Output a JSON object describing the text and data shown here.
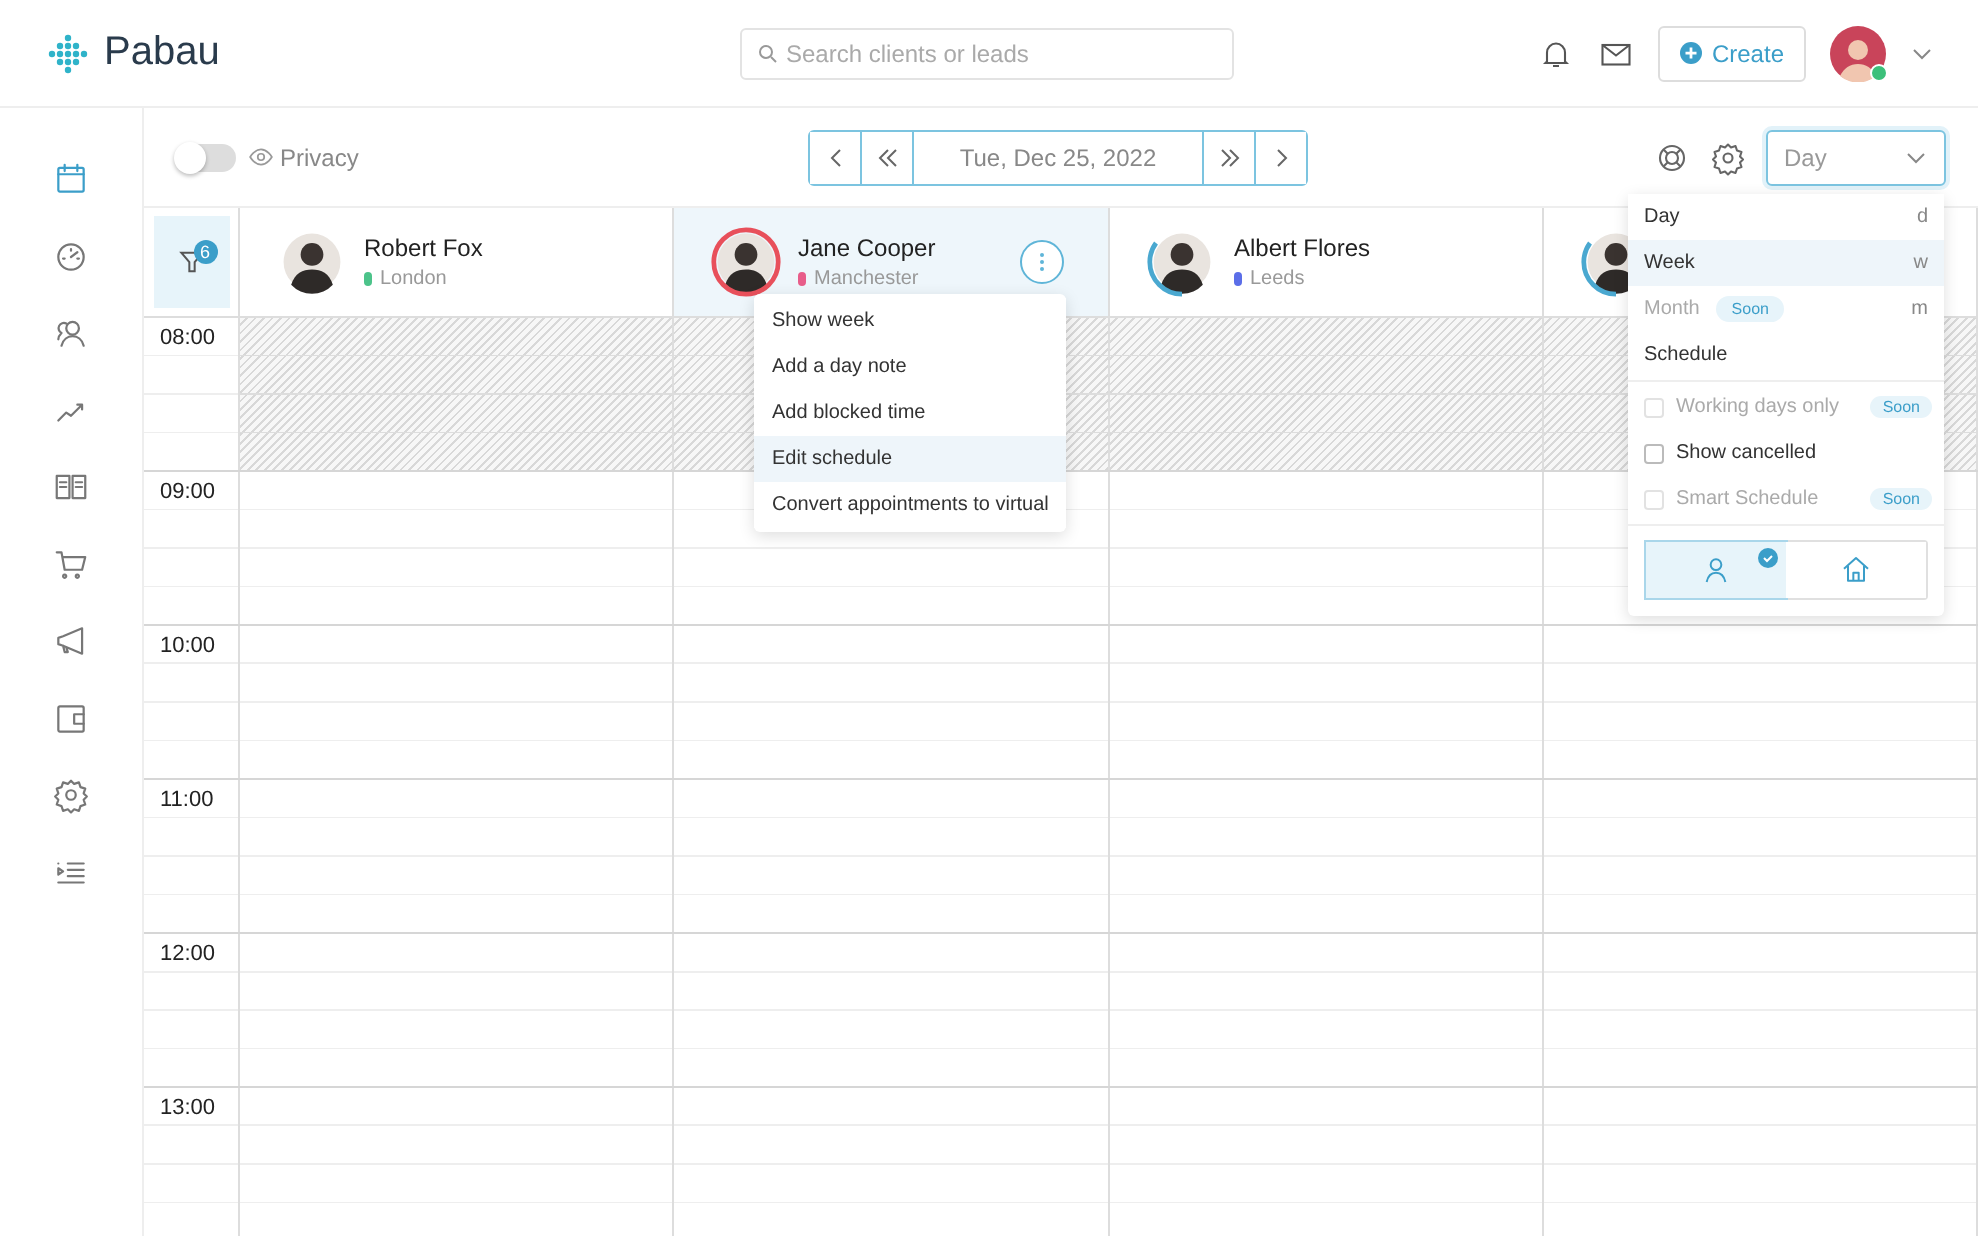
{
  "brand": {
    "name": "Pabau"
  },
  "search": {
    "placeholder": "Search clients or leads"
  },
  "header_actions": {
    "create": "Create",
    "user_online": true
  },
  "nav": [
    {
      "selected": true
    },
    {
      "selected": false
    },
    {
      "selected": false
    },
    {
      "selected": false
    },
    {
      "selected": false
    },
    {
      "selected": false
    },
    {
      "selected": false
    },
    {
      "selected": false
    },
    {
      "selected": false
    },
    {
      "selected": false
    }
  ],
  "toolbar": {
    "privacy": {
      "label": "Privacy",
      "on": false
    },
    "date": "Tue, Dec 25, 2022",
    "view": "Day"
  },
  "filter": {
    "count": "6"
  },
  "staff": [
    {
      "name": "Robert Fox",
      "location": "London",
      "color": "#4cc38a",
      "selected": false,
      "kind": "plain"
    },
    {
      "name": "Jane Cooper",
      "location": "Manchester",
      "color": "#e85d8a",
      "selected": true,
      "kind": "alert"
    },
    {
      "name": "Albert Flores",
      "location": "Leeds",
      "color": "#5b6ee8",
      "selected": false,
      "kind": "progress"
    },
    {
      "selected": false,
      "kind": "progress"
    }
  ],
  "hours": [
    {
      "label": "08:00",
      "blocked": true
    },
    {
      "label": "09:00",
      "blocked": false
    },
    {
      "label": "10:00",
      "blocked": false
    },
    {
      "label": "11:00",
      "blocked": false
    },
    {
      "label": "12:00",
      "blocked": false
    },
    {
      "label": "13:00",
      "blocked": false
    }
  ],
  "staff_menu": {
    "items": [
      {
        "label": "Show week",
        "highlighted": false
      },
      {
        "label": "Add a day note",
        "highlighted": false
      },
      {
        "label": "Add blocked time",
        "highlighted": false
      },
      {
        "label": "Edit schedule",
        "highlighted": true
      },
      {
        "label": "Convert appointments to virtual",
        "highlighted": false
      }
    ]
  },
  "view_menu": {
    "views": [
      {
        "label": "Day",
        "shortcut": "d",
        "highlighted": false,
        "disabled": false
      },
      {
        "label": "Week",
        "shortcut": "w",
        "highlighted": true,
        "disabled": false
      },
      {
        "label": "Month",
        "shortcut": "m",
        "highlighted": false,
        "disabled": true,
        "badge": "Soon"
      },
      {
        "label": "Schedule",
        "highlighted": false,
        "disabled": false
      }
    ],
    "options": [
      {
        "label": "Working days only",
        "checked": false,
        "disabled": true,
        "badge": "Soon"
      },
      {
        "label": "Show cancelled",
        "checked": false,
        "disabled": false
      },
      {
        "label": "Smart Schedule",
        "checked": false,
        "disabled": true,
        "badge": "Soon"
      }
    ],
    "modes": [
      {
        "selected": true
      },
      {
        "selected": false
      }
    ]
  }
}
